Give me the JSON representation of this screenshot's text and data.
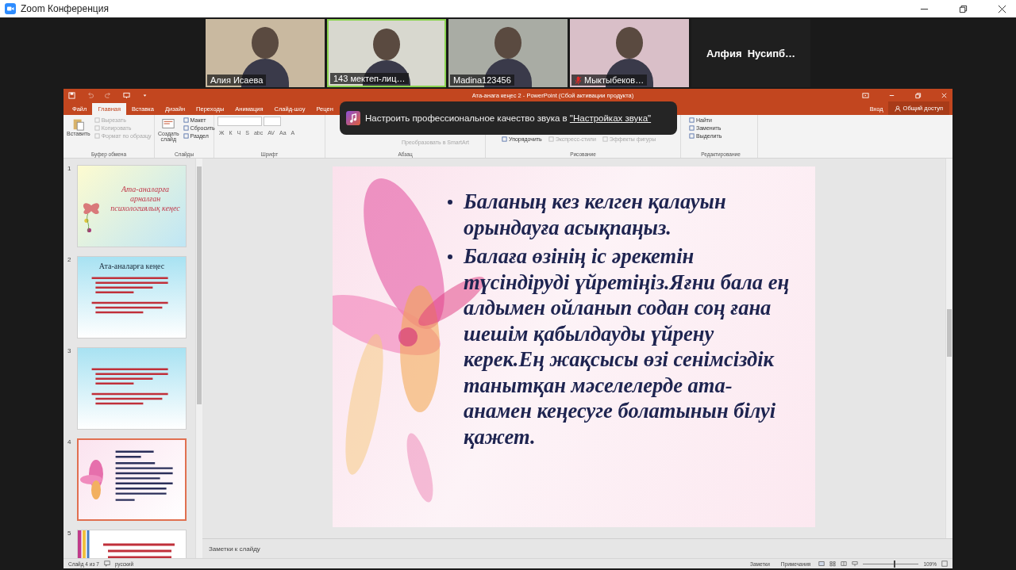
{
  "zoom_window": {
    "title": "Zoom Конференция"
  },
  "participants": [
    {
      "name": "Алия Исаева",
      "speaking": false,
      "muted": false
    },
    {
      "name": "143 мектеп-лиц…",
      "speaking": true,
      "muted": false
    },
    {
      "name": "Madina123456",
      "speaking": false,
      "muted": false
    },
    {
      "name": "Мыктыбеков…",
      "speaking": false,
      "muted": true
    }
  ],
  "name_tile": {
    "name": "Алфия  Нусипб…"
  },
  "powerpoint": {
    "title": "Ата-анага кеңес 2 - PowerPoint (Сбой активации продукта)",
    "tabs": [
      {
        "label": "Файл",
        "selected": false
      },
      {
        "label": "Главная",
        "selected": true
      },
      {
        "label": "Вставка",
        "selected": false
      },
      {
        "label": "Дизайн",
        "selected": false
      },
      {
        "label": "Переходы",
        "selected": false
      },
      {
        "label": "Анимация",
        "selected": false
      },
      {
        "label": "Слайд-шоу",
        "selected": false
      },
      {
        "label": "Рецен",
        "selected": false
      }
    ],
    "sign_in": "Вход",
    "share": "Общий доступ",
    "notification": {
      "text": "Настроить профессиональное качество звука в ",
      "link": "\"Настройках звука\""
    },
    "ribbon": [
      {
        "kind": "clipboard",
        "label": "Буфер обмена",
        "large": "Вставить",
        "items": [
          {
            "label": "Вырезать",
            "disabled": true
          },
          {
            "label": "Копировать",
            "disabled": true
          },
          {
            "label": "Формат по образцу",
            "disabled": true
          }
        ]
      },
      {
        "kind": "slides",
        "label": "Слайды",
        "large": "Создать слайд",
        "items": [
          {
            "label": "Макет",
            "disabled": false
          },
          {
            "label": "Сбросить",
            "disabled": false
          },
          {
            "label": "Раздел",
            "disabled": false
          }
        ]
      },
      {
        "kind": "font",
        "label": "Шрифт",
        "buttons": [
          "Ж",
          "К",
          "Ч",
          "S",
          "abc",
          "AV",
          "Aa",
          "A"
        ]
      },
      {
        "kind": "paragraph",
        "label": "Абзац",
        "items": [
          {
            "label": "Преобразовать в SmartArt",
            "disabled": true
          }
        ]
      },
      {
        "kind": "drawing",
        "label": "Рисование",
        "items": [
          {
            "label": "Упорядочить",
            "disabled": false
          },
          {
            "label": "Экспресс-стили",
            "disabled": true
          },
          {
            "label": "Эффекты фигуры",
            "disabled": true
          }
        ]
      },
      {
        "kind": "editing",
        "label": "Редактирование",
        "items": [
          {
            "label": "Найти",
            "disabled": false
          },
          {
            "label": "Заменить",
            "disabled": false
          },
          {
            "label": "Выделить",
            "disabled": false
          }
        ]
      }
    ],
    "slides": [
      {
        "number": "1",
        "kind": "pastel",
        "title": "Ата-аналарға арналған психологиялық кеңес",
        "selected": false
      },
      {
        "number": "2",
        "kind": "sky",
        "title": "Ата-аналарға кеңес",
        "selected": false
      },
      {
        "number": "3",
        "kind": "sky",
        "selected": false
      },
      {
        "number": "4",
        "kind": "flower",
        "selected": true
      },
      {
        "number": "5",
        "kind": "stripes",
        "selected": false
      }
    ],
    "slide": {
      "bullets": [
        "Баланың кез келген қалауын орындауға асықпаңыз.",
        "Балаға өзінің іс әрекетін түсіндіруді үйретіңіз.Яғни бала ең алдымен ойланып содан соң ғана шешім қабылдауды үйрену керек.Ең жақсысы өзі сенімсіздік танытқан мәселелерде ата-анамен кеңесуге болатынын білуі қажет."
      ]
    },
    "notes_placeholder": "Заметки к слайду",
    "status": {
      "slide_count": "Слайд 4 из 7",
      "language": "русский",
      "notes": "Заметки",
      "comments": "Примечания",
      "zoom": "109%",
      "level": 0.55
    }
  }
}
